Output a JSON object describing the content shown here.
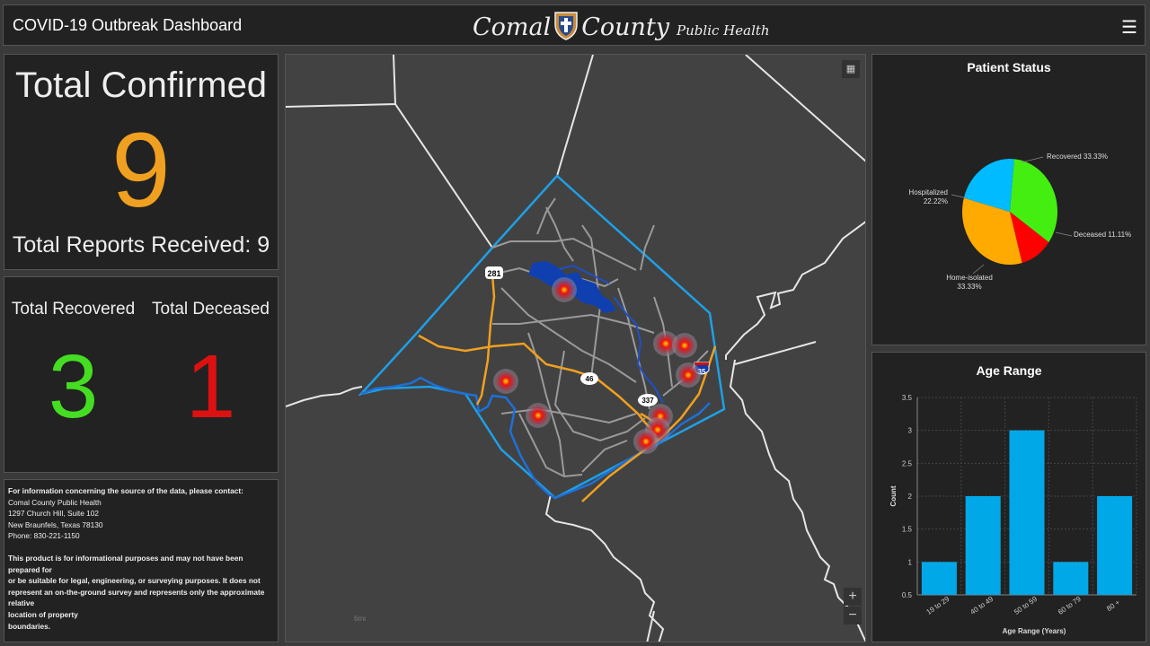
{
  "header": {
    "title": "COVID-19 Outbreak Dashboard",
    "logo_word1": "Comal",
    "logo_word2": "County",
    "logo_word3": "Public Health",
    "menu_icon": "hamburger-icon"
  },
  "confirmed": {
    "title": "Total Confirmed",
    "value": "9",
    "reports": "Total Reports Received: 9",
    "color": "#f0a020"
  },
  "outcomes": {
    "recovered_label": "Total Recovered",
    "recovered_value": "3",
    "recovered_color": "#44dd22",
    "deceased_label": "Total Deceased",
    "deceased_value": "1",
    "deceased_color": "#dd1111"
  },
  "info": {
    "intro": "For information concerning the source of the data, please contact:",
    "org": "Comal County Public Health",
    "address1": "1297 Church Hill, Suite 102",
    "address2": "New Braunfels, Texas 78130",
    "phone": "Phone: 830-221-1150",
    "disclaimer_l1": "This product is for informational purposes and may not have been prepared for",
    "disclaimer_l2": "or be suitable for legal, engineering, or surveying purposes. It does not",
    "disclaimer_l3": "represent an on-the-ground survey and represents only the approximate relative",
    "disclaimer_l4": "location of property",
    "disclaimer_l5": "boundaries."
  },
  "map": {
    "road_labels": [
      "281",
      "46",
      "337"
    ],
    "interstate_label": "35",
    "zoom_in": "+",
    "zoom_out": "−",
    "scale_label": "6mi",
    "case_marker_count": 9,
    "colors": {
      "county_boundary": "#1ea0e6",
      "highway": "#f0a020",
      "river": "#1e70d8",
      "lake": "#1040b0"
    }
  },
  "patient_status": {
    "title": "Patient Status",
    "chart_data": {
      "type": "pie",
      "slices": [
        {
          "label": "Recovered",
          "pct_label": "33.33%",
          "value": 33.33,
          "color": "#44ee11"
        },
        {
          "label": "Deceased",
          "pct_label": "11.11%",
          "value": 11.11,
          "color": "#ff0000"
        },
        {
          "label": "Home-isolated",
          "pct_label": "33.33%",
          "value": 33.33,
          "color": "#ffaa00"
        },
        {
          "label": "Hospitalized",
          "pct_label": "22.22%",
          "value": 22.22,
          "color": "#00bbff"
        }
      ]
    }
  },
  "age_range": {
    "title": "Age Range",
    "chart_data": {
      "type": "bar",
      "categories": [
        "19 to 29",
        "40 to 49",
        "50 to 59",
        "60 to 79",
        "80 +"
      ],
      "values": [
        1,
        2,
        3,
        1,
        2
      ],
      "xlabel": "Age Range (Years)",
      "ylabel": "Count",
      "ylim": [
        0.5,
        3.5
      ],
      "yticks": [
        "0.5",
        "1",
        "1.5",
        "2",
        "2.5",
        "3",
        "3.5"
      ],
      "grid": true,
      "color": "#00a8e8"
    }
  }
}
